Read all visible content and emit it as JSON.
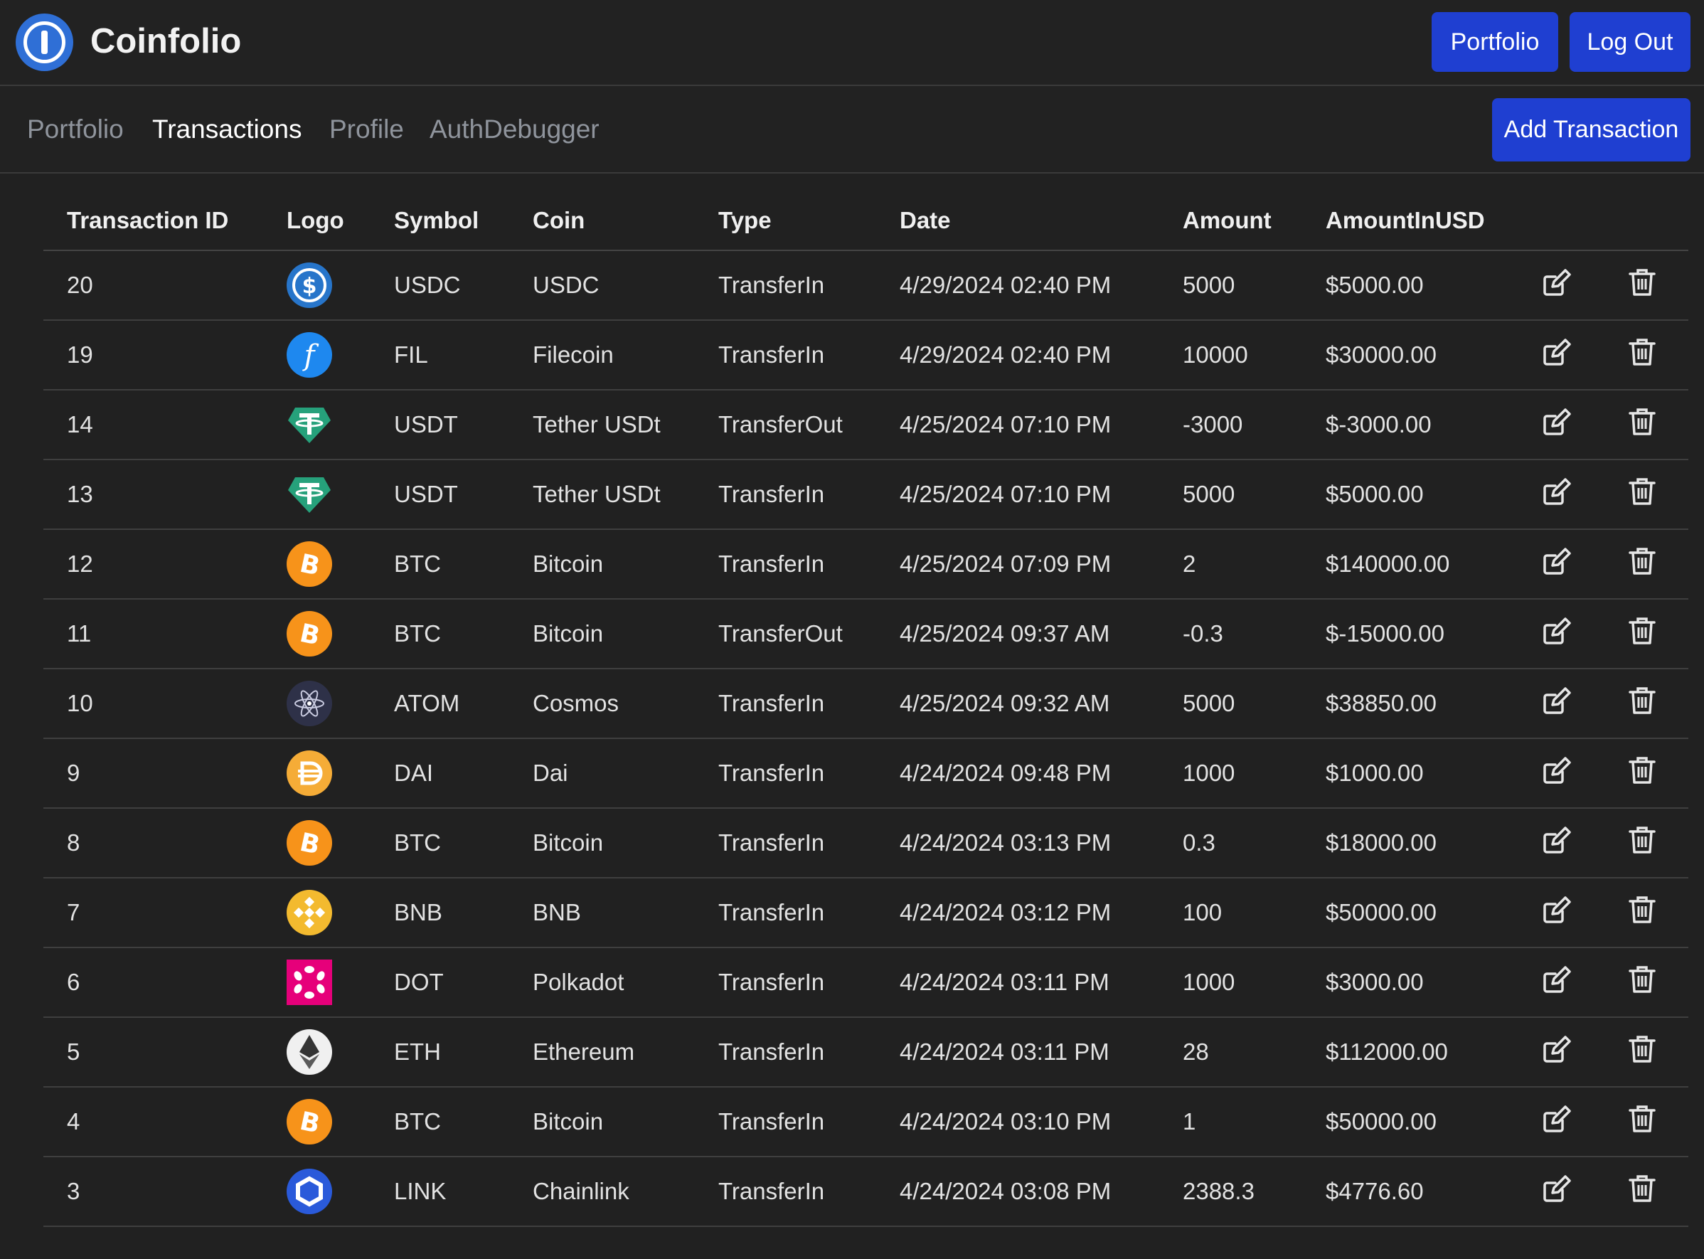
{
  "app": {
    "title": "Coinfolio"
  },
  "header": {
    "portfolio_label": "Portfolio",
    "logout_label": "Log Out"
  },
  "nav": {
    "items": [
      {
        "label": "Portfolio",
        "active": false
      },
      {
        "label": "Transactions",
        "active": true
      },
      {
        "label": "Profile",
        "active": false
      },
      {
        "label": "AuthDebugger",
        "active": false
      }
    ],
    "add_label": "Add Transaction"
  },
  "colors": {
    "accent": "#1f3fd1",
    "background": "#212121",
    "logo_blue": "#2f6fd6"
  },
  "table": {
    "headers": [
      "Transaction ID",
      "Logo",
      "Symbol",
      "Coin",
      "Type",
      "Date",
      "Amount",
      "AmountInUSD"
    ],
    "rows": [
      {
        "id": "20",
        "logo": "usdc-icon",
        "symbol": "USDC",
        "coin": "USDC",
        "type": "TransferIn",
        "date": "4/29/2024 02:40 PM",
        "amount": "5000",
        "usd": "$5000.00"
      },
      {
        "id": "19",
        "logo": "fil-icon",
        "symbol": "FIL",
        "coin": "Filecoin",
        "type": "TransferIn",
        "date": "4/29/2024 02:40 PM",
        "amount": "10000",
        "usd": "$30000.00"
      },
      {
        "id": "14",
        "logo": "usdt-icon",
        "symbol": "USDT",
        "coin": "Tether USDt",
        "type": "TransferOut",
        "date": "4/25/2024 07:10 PM",
        "amount": "-3000",
        "usd": "$-3000.00"
      },
      {
        "id": "13",
        "logo": "usdt-icon",
        "symbol": "USDT",
        "coin": "Tether USDt",
        "type": "TransferIn",
        "date": "4/25/2024 07:10 PM",
        "amount": "5000",
        "usd": "$5000.00"
      },
      {
        "id": "12",
        "logo": "btc-icon",
        "symbol": "BTC",
        "coin": "Bitcoin",
        "type": "TransferIn",
        "date": "4/25/2024 07:09 PM",
        "amount": "2",
        "usd": "$140000.00"
      },
      {
        "id": "11",
        "logo": "btc-icon",
        "symbol": "BTC",
        "coin": "Bitcoin",
        "type": "TransferOut",
        "date": "4/25/2024 09:37 AM",
        "amount": "-0.3",
        "usd": "$-15000.00"
      },
      {
        "id": "10",
        "logo": "atom-icon",
        "symbol": "ATOM",
        "coin": "Cosmos",
        "type": "TransferIn",
        "date": "4/25/2024 09:32 AM",
        "amount": "5000",
        "usd": "$38850.00"
      },
      {
        "id": "9",
        "logo": "dai-icon",
        "symbol": "DAI",
        "coin": "Dai",
        "type": "TransferIn",
        "date": "4/24/2024 09:48 PM",
        "amount": "1000",
        "usd": "$1000.00"
      },
      {
        "id": "8",
        "logo": "btc-icon",
        "symbol": "BTC",
        "coin": "Bitcoin",
        "type": "TransferIn",
        "date": "4/24/2024 03:13 PM",
        "amount": "0.3",
        "usd": "$18000.00"
      },
      {
        "id": "7",
        "logo": "bnb-icon",
        "symbol": "BNB",
        "coin": "BNB",
        "type": "TransferIn",
        "date": "4/24/2024 03:12 PM",
        "amount": "100",
        "usd": "$50000.00"
      },
      {
        "id": "6",
        "logo": "dot-icon",
        "symbol": "DOT",
        "coin": "Polkadot",
        "type": "TransferIn",
        "date": "4/24/2024 03:11 PM",
        "amount": "1000",
        "usd": "$3000.00"
      },
      {
        "id": "5",
        "logo": "eth-icon",
        "symbol": "ETH",
        "coin": "Ethereum",
        "type": "TransferIn",
        "date": "4/24/2024 03:11 PM",
        "amount": "28",
        "usd": "$112000.00"
      },
      {
        "id": "4",
        "logo": "btc-icon",
        "symbol": "BTC",
        "coin": "Bitcoin",
        "type": "TransferIn",
        "date": "4/24/2024 03:10 PM",
        "amount": "1",
        "usd": "$50000.00"
      },
      {
        "id": "3",
        "logo": "link-icon",
        "symbol": "LINK",
        "coin": "Chainlink",
        "type": "TransferIn",
        "date": "4/24/2024 03:08 PM",
        "amount": "2388.3",
        "usd": "$4776.60"
      }
    ]
  }
}
